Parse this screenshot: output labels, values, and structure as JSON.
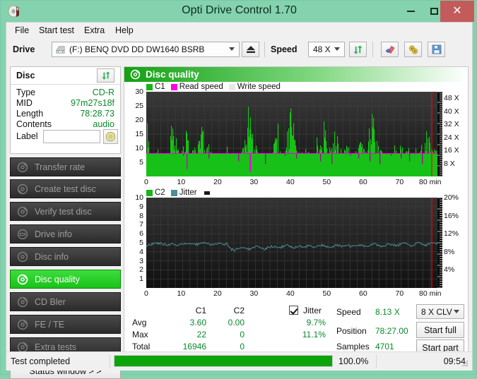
{
  "window": {
    "title": "Opti Drive Control 1.70",
    "icon": "disc-icon",
    "minimize": "–",
    "maximize": "□",
    "close": "✕"
  },
  "menu": {
    "items": [
      {
        "label": "File",
        "name": "menu-file"
      },
      {
        "label": "Start test",
        "name": "menu-start-test"
      },
      {
        "label": "Extra",
        "name": "menu-extra"
      },
      {
        "label": "Help",
        "name": "menu-help"
      }
    ]
  },
  "toolbar": {
    "drive_label": "Drive",
    "drive_value": "(F:)   BENQ DVD DD DW1640 BSRB",
    "eject_icon": "eject-icon",
    "speed_label": "Speed",
    "speed_value": "48 X",
    "refresh_icon": "refresh-icon",
    "erase_icon": "eraser-icon",
    "settings_icon": "gear-icon",
    "save_icon": "save-icon"
  },
  "disc_panel": {
    "header": "Disc",
    "refresh_icon": "refresh-icon",
    "rows": [
      {
        "label": "Type",
        "value": "CD-R"
      },
      {
        "label": "MID",
        "value": "97m27s18f"
      },
      {
        "label": "Length",
        "value": "78:28.73"
      },
      {
        "label": "Contents",
        "value": "audio"
      }
    ],
    "label_field_label": "Label",
    "label_field_value": "",
    "label_field_placeholder": "",
    "label_button_icon": "cd-icon"
  },
  "sidebar": {
    "items": [
      {
        "label": "Transfer rate",
        "icon": "disc-icon",
        "active": false
      },
      {
        "label": "Create test disc",
        "icon": "disc-icon",
        "active": false
      },
      {
        "label": "Verify test disc",
        "icon": "disc-icon",
        "active": false
      },
      {
        "label": "Drive info",
        "icon": "drive-icon",
        "active": false
      },
      {
        "label": "Disc info",
        "icon": "disc-icon",
        "active": false
      },
      {
        "label": "Disc quality",
        "icon": "disc-icon",
        "active": true
      },
      {
        "label": "CD Bler",
        "icon": "disc-icon",
        "active": false
      },
      {
        "label": "FE / TE",
        "icon": "disc-icon",
        "active": false
      },
      {
        "label": "Extra tests",
        "icon": "disc-icon",
        "active": false
      }
    ],
    "status_window_button": "Status window > >"
  },
  "panel": {
    "title": "Disc quality",
    "icon": "disc-quality-icon"
  },
  "chart_data": [
    {
      "type": "bar",
      "name": "c1-chart",
      "title": "",
      "xlabel": "80 min",
      "ylabel": "",
      "ylim": [
        0,
        30
      ],
      "yticks": [
        5,
        10,
        15,
        20,
        25,
        30
      ],
      "xlim": [
        0,
        80
      ],
      "xticks": [
        0,
        10,
        20,
        30,
        40,
        50,
        60,
        70,
        80
      ],
      "xtick_labels": [
        "0",
        "10",
        "20",
        "30",
        "40",
        "50",
        "60",
        "70",
        "80 min"
      ],
      "y2lim": [
        0,
        52
      ],
      "y2ticks": [
        8,
        16,
        24,
        32,
        40,
        48
      ],
      "y2tick_labels": [
        "8 X",
        "16 X",
        "24 X",
        "32 X",
        "40 X",
        "48 X"
      ],
      "grid": true,
      "legend": [
        {
          "label": "C1",
          "color": "#16b516"
        },
        {
          "label": "Read speed",
          "color": "#ff00e6"
        },
        {
          "label": "Write speed",
          "color": "#e8e8e8"
        }
      ],
      "series": [
        {
          "name": "C1",
          "color": "#16b516",
          "values": [
            19,
            7,
            6,
            9,
            7,
            6,
            5,
            16,
            13,
            7,
            9,
            16,
            6,
            12,
            9,
            18,
            8,
            10,
            6,
            7,
            6,
            6,
            9,
            7,
            5,
            6,
            6,
            12,
            22,
            14,
            9,
            8,
            7,
            6,
            7,
            11,
            15,
            8,
            7,
            19,
            21,
            10,
            8,
            7,
            10,
            7,
            8,
            12,
            9,
            17,
            8,
            14,
            16,
            9,
            7,
            11,
            8,
            7,
            10,
            11,
            9,
            12,
            21,
            14,
            9,
            8,
            7,
            6,
            10,
            9,
            11,
            8,
            10,
            7,
            9,
            8,
            11,
            13,
            10,
            9
          ]
        },
        {
          "name": "Read speed",
          "color": "#ff00e6",
          "values": [
            8.13,
            8.13,
            8.13,
            8.13,
            8.13,
            8.13,
            8.13,
            8.13,
            8.13,
            8.13,
            8.13,
            8.13,
            8.13,
            8.13,
            8.13,
            8.13,
            8.13,
            8.13,
            8.13,
            8.13,
            8.13,
            8.13,
            8.13,
            8.13,
            8.13,
            8.13,
            8.13,
            8.13,
            8.13,
            8.13,
            8.13,
            8.13,
            8.13,
            8.13,
            8.13,
            8.13,
            8.13,
            8.13,
            8.13,
            8.13,
            8.13,
            8.13,
            8.13,
            8.13,
            8.13,
            8.13,
            8.13,
            8.13,
            8.13,
            8.13,
            8.13,
            8.13,
            8.13,
            8.13,
            8.13,
            8.13,
            8.13,
            8.13,
            8.13,
            8.13,
            8.13,
            8.13,
            8.13,
            8.13,
            8.13,
            8.13,
            8.13,
            8.13,
            8.13,
            8.13,
            8.13,
            8.13,
            8.13,
            8.13,
            8.13,
            8.13,
            8.13,
            8.13,
            8.13,
            8.13
          ]
        }
      ],
      "cursor_position_min": 78.45,
      "cursor_color": "#ff0000"
    },
    {
      "type": "line",
      "name": "c2-jitter-chart",
      "title": "",
      "xlabel": "80 min",
      "ylabel": "",
      "ylim": [
        0,
        10
      ],
      "yticks": [
        1,
        2,
        3,
        4,
        5,
        6,
        7,
        8,
        9,
        10
      ],
      "xlim": [
        0,
        80
      ],
      "xticks": [
        0,
        10,
        20,
        30,
        40,
        50,
        60,
        70,
        80
      ],
      "xtick_labels": [
        "0",
        "10",
        "20",
        "30",
        "40",
        "50",
        "60",
        "70",
        "80 min"
      ],
      "y2lim": [
        0,
        20
      ],
      "y2ticks": [
        4,
        8,
        12,
        16,
        20
      ],
      "y2tick_labels": [
        "4%",
        "8%",
        "12%",
        "16%",
        "20%"
      ],
      "grid": true,
      "legend": [
        {
          "label": "C2",
          "color": "#16b516"
        },
        {
          "label": "Jitter",
          "color": "#4d8f94"
        }
      ],
      "series": [
        {
          "name": "C2",
          "color": "#16b516",
          "values": [
            0,
            0,
            0,
            0,
            0,
            0,
            0,
            0,
            0,
            0,
            0,
            0,
            0,
            0,
            0,
            0,
            0,
            0,
            0,
            0,
            0,
            0,
            0,
            0,
            0,
            0,
            0,
            0,
            0,
            0,
            0,
            0,
            0,
            0,
            0,
            0,
            0,
            0,
            0,
            0,
            0,
            0,
            0,
            0,
            0,
            0,
            0,
            0,
            0,
            0,
            0,
            0,
            0,
            0,
            0,
            0,
            0,
            0,
            0,
            0,
            0,
            0,
            0,
            0,
            0,
            0,
            0,
            0,
            0,
            0,
            0,
            0,
            0,
            0,
            0,
            0,
            0,
            0,
            0,
            0
          ]
        },
        {
          "name": "Jitter",
          "color": "#4d8f94",
          "values": [
            9.4,
            9.6,
            9.8,
            9.9,
            9.8,
            9.7,
            9.6,
            9.8,
            9.6,
            9.5,
            9.7,
            9.8,
            9.9,
            9.7,
            9.6,
            9.8,
            9.9,
            9.7,
            9.6,
            9.8,
            9.9,
            9.8,
            9.7,
            8.6,
            8.4,
            8.8,
            9.0,
            8.7,
            8.6,
            8.9,
            9.2,
            8.8,
            8.6,
            9.0,
            9.3,
            9.1,
            8.8,
            9.2,
            9.4,
            9.2,
            8.9,
            9.3,
            9.2,
            9.0,
            9.4,
            9.2,
            9.0,
            9.3,
            9.5,
            9.2,
            8.9,
            9.3,
            9.4,
            9.2,
            9.5,
            9.3,
            9.1,
            9.4,
            9.6,
            9.3,
            9.2,
            9.5,
            9.7,
            9.4,
            9.2,
            9.6,
            9.8,
            9.5,
            9.3,
            9.7,
            9.9,
            9.6,
            9.4,
            9.8,
            10.0,
            9.7,
            9.5,
            9.9,
            10.0,
            9.8
          ]
        }
      ],
      "cursor_position_min": 78.45,
      "cursor_color": "#ff0000"
    }
  ],
  "stats": {
    "col_headers": [
      "C1",
      "C2"
    ],
    "jitter_label": "Jitter",
    "jitter_checked": true,
    "rows": [
      {
        "label": "Avg",
        "c1": "3.60",
        "c2": "0.00",
        "jitter": "9.7%"
      },
      {
        "label": "Max",
        "c1": "22",
        "c2": "0",
        "jitter": "11.1%"
      },
      {
        "label": "Total",
        "c1": "16946",
        "c2": "0",
        "jitter": ""
      }
    ],
    "info": [
      {
        "label": "Speed",
        "value": "8.13 X"
      },
      {
        "label": "Position",
        "value": "78:27.00"
      },
      {
        "label": "Samples",
        "value": "4701"
      }
    ],
    "speed_select": "8 X CLV",
    "start_full": "Start full",
    "start_part": "Start part"
  },
  "statusbar": {
    "message": "Test completed",
    "progress_percent": "100.0%",
    "progress_value": 100,
    "elapsed": "09:54"
  },
  "colors": {
    "accent_green": "#16b516",
    "value_green": "#0a8a2a",
    "titlebar": "#84d2ae",
    "close_red": "#c35b5b",
    "jitter_teal": "#4d8f94",
    "read_speed_magenta": "#ff00e6",
    "cursor_red": "#ff0000"
  }
}
